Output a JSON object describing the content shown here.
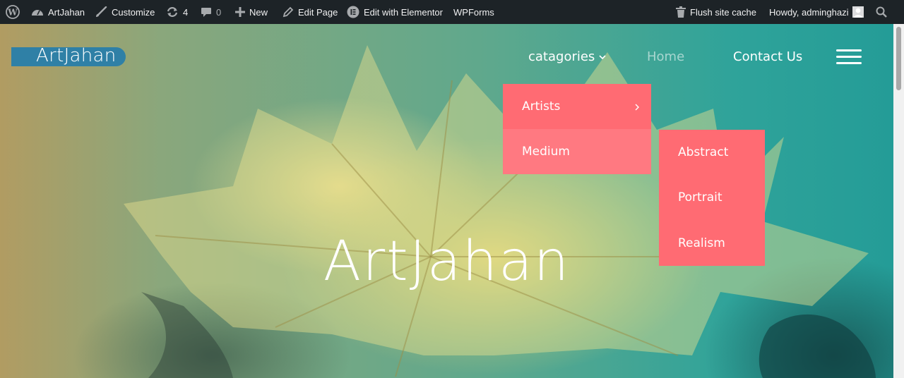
{
  "adminbar": {
    "site_name": "ArtJahan",
    "customize": "Customize",
    "updates_count": "4",
    "comments_count": "0",
    "new": "New",
    "edit_page": "Edit Page",
    "edit_elementor": "Edit with Elementor",
    "wpforms": "WPForms",
    "flush_cache": "Flush site cache",
    "howdy": "Howdy, adminghazi"
  },
  "site": {
    "logo": "ArtJahan",
    "hero_title": "ArtJahan"
  },
  "nav": {
    "categories": "catagories",
    "home": "Home",
    "contact": "Contact Us"
  },
  "dropdown": {
    "items": [
      "Artists",
      "Medium"
    ],
    "submenu_items": [
      "Abstract",
      "Portrait",
      "Realism"
    ]
  },
  "colors": {
    "adminbar_bg": "#1d2327",
    "menu_bg": "#ff6b73",
    "logo_bg": "#2f80a6"
  }
}
